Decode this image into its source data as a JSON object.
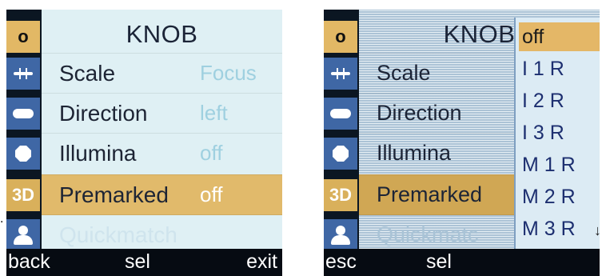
{
  "left_screen": {
    "title": "KNOB",
    "side_icons": [
      "o-icon",
      "minus-icon",
      "pill-icon",
      "octagon-icon",
      "3d-icon",
      "user-icon"
    ],
    "side_o": "o",
    "side_3d": "3D",
    "rows": [
      {
        "label": "Scale",
        "value": "Focus"
      },
      {
        "label": "Direction",
        "value": "left"
      },
      {
        "label": "Illumina",
        "value": "off"
      },
      {
        "label": "Premarked",
        "value": "off"
      },
      {
        "label": "Quickmatch",
        "value": ""
      }
    ],
    "bottom": {
      "left": "back",
      "middle": "sel",
      "right": "exit"
    },
    "colors": {
      "highlight": "#e1ba6b",
      "side_blue": "#3f67a5"
    }
  },
  "right_screen": {
    "title": "KNOB",
    "side_o": "o",
    "side_3d": "3D",
    "rows": [
      {
        "label": "Scale"
      },
      {
        "label": "Direction"
      },
      {
        "label": "Illumina"
      },
      {
        "label": "Premarked"
      },
      {
        "label": "Quickmatc"
      }
    ],
    "dropdown": {
      "options": [
        "off",
        "I 1 R",
        "I 2 R",
        "I 3 R",
        "M 1 R",
        "M 2 R",
        "M 3 R"
      ],
      "selected": "off",
      "more_arrow": "↓"
    },
    "bottom": {
      "left": "esc",
      "middle": "sel"
    }
  },
  "left_dot": "."
}
